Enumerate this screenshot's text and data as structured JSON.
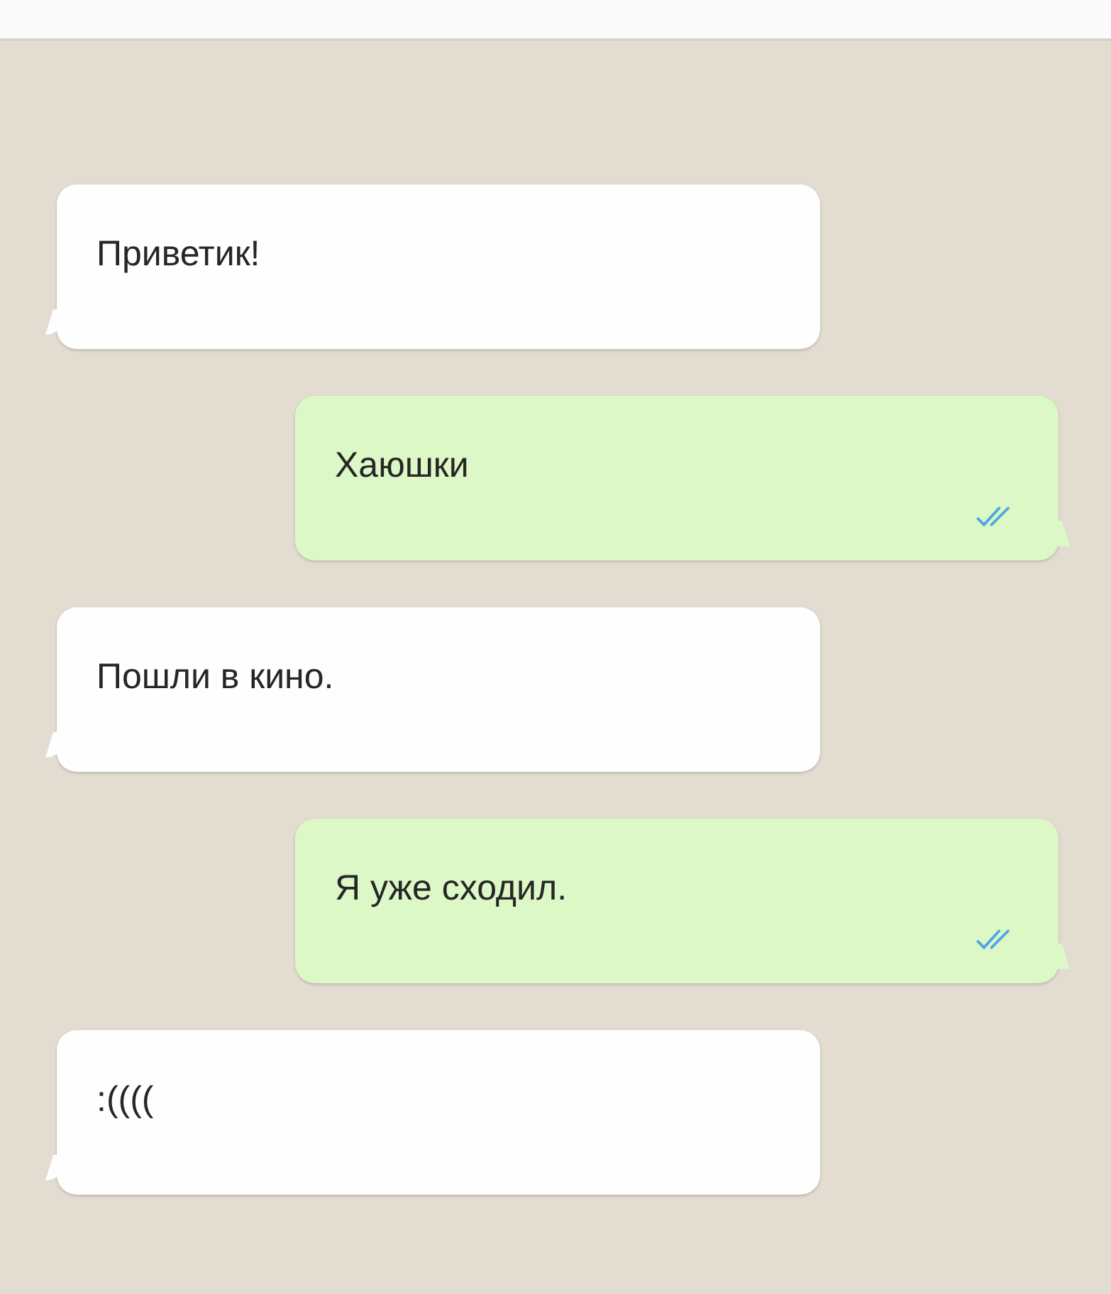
{
  "messages": [
    {
      "kind": "incoming",
      "text": "Приветик!"
    },
    {
      "kind": "outgoing",
      "text": "Хаюшки",
      "read": true
    },
    {
      "kind": "incoming",
      "text": "Пошли в кино."
    },
    {
      "kind": "outgoing",
      "text": "Я уже сходил.",
      "read": true
    },
    {
      "kind": "incoming",
      "text": ":(((("
    }
  ]
}
